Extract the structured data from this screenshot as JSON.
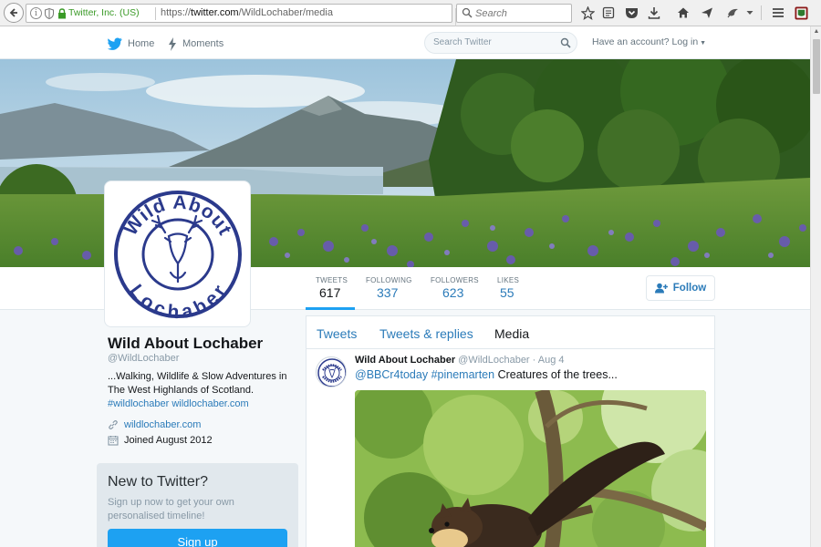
{
  "browser": {
    "identity": "Twitter, Inc. (US)",
    "url_prefix": "https://",
    "url_host": "twitter.com",
    "url_path": "/WildLochaber/media",
    "search_placeholder": "Search"
  },
  "twitter_nav": {
    "home_label": "Home",
    "moments_label": "Moments",
    "search_placeholder": "Search Twitter",
    "login_text": "Have an account? Log in"
  },
  "stats": [
    {
      "label": "TWEETS",
      "value": "617"
    },
    {
      "label": "FOLLOWING",
      "value": "337"
    },
    {
      "label": "FOLLOWERS",
      "value": "623"
    },
    {
      "label": "LIKES",
      "value": "55"
    }
  ],
  "follow_label": "Follow",
  "profile": {
    "name": "Wild About Lochaber",
    "handle": "@WildLochaber",
    "bio": "...Walking, Wildlife & Slow Adventures in The West Highlands of Scotland.",
    "bio_hashtag": "#wildlochaber",
    "bio_link": "wildlochaber.com",
    "website": "wildlochaber.com",
    "joined": "Joined August 2012",
    "logo_top": "Wild About",
    "logo_bottom": "Lochaber"
  },
  "signup_box": {
    "title": "New to Twitter?",
    "description": "Sign up now to get your own personalised timeline!",
    "button": "Sign up"
  },
  "tabs": [
    "Tweets",
    "Tweets & replies",
    "Media"
  ],
  "tweet": {
    "name": "Wild About Lochaber",
    "handle": "@WildLochaber",
    "separator": "·",
    "date": "Aug 4",
    "mention": "@BBCr4today",
    "hashtag": "#pinemarten",
    "text": "Creatures of the trees..."
  },
  "colors": {
    "twitter_blue": "#1da1f2",
    "link_blue": "#2b7bb9",
    "logo_navy": "#2b3a8c"
  }
}
